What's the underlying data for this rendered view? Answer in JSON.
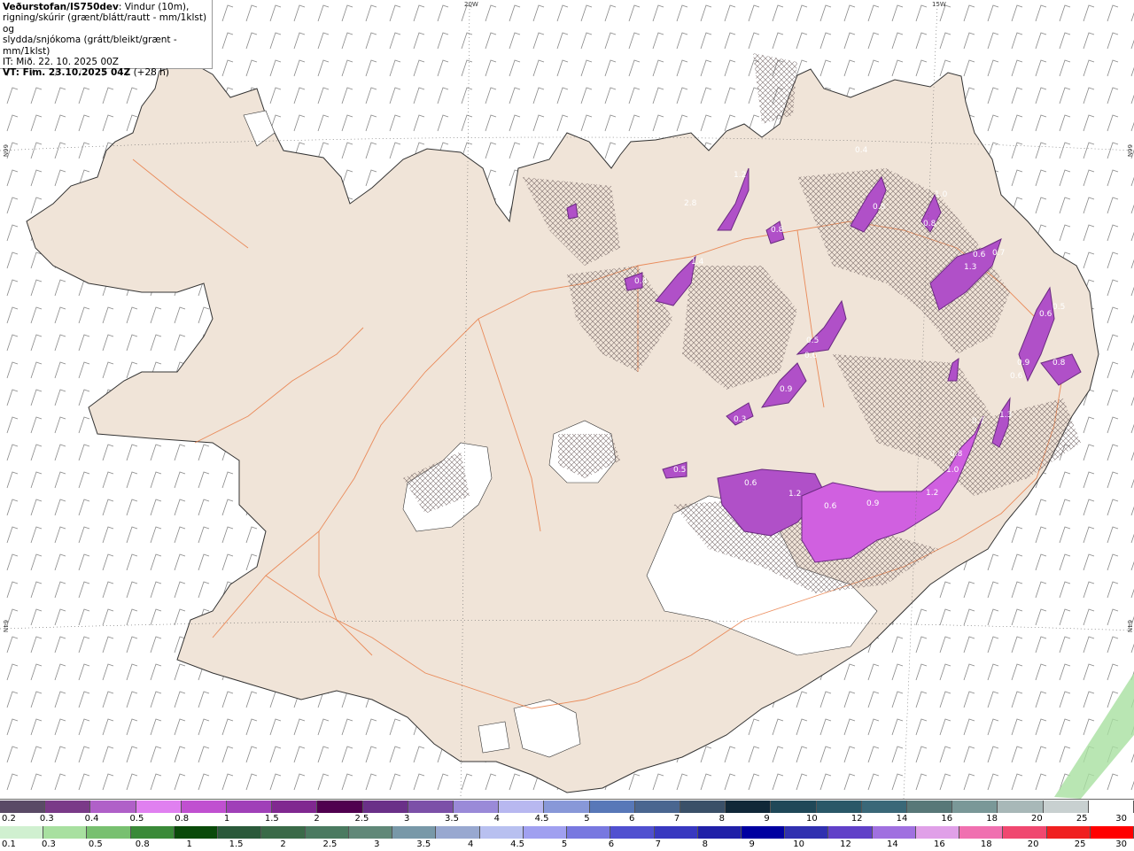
{
  "info": {
    "source": "Veðurstofan/IS750dev",
    "line1_rest": ": Vindur (10m),",
    "line2": "rigning/skúrir (grænt/blátt/rautt - mm/1klst) og",
    "line3": "slydda/snjókoma (grátt/bleikt/grænt - mm/1klst)",
    "it": "IT: Mið. 22. 10. 2025 00Z",
    "vt_bold": "VT: Fim. 23.10.2025 04Z",
    "vt_rest": " (+28 h)"
  },
  "grid_labels": {
    "top_20w": "20W",
    "top_15w": "15W",
    "left_66n": "66N",
    "right_66n": "66N",
    "left_64n": "64N",
    "right_64n": "64N"
  },
  "precip_values": [
    "0.4",
    "0.8",
    "1.0",
    "0.8",
    "0.8",
    "1.2",
    "2.8",
    "1.3",
    "0.7",
    "0.6",
    "0.5",
    "0.6",
    "0.9",
    "0.6",
    "0.8",
    "0.5",
    "0.6",
    "0.9",
    "0.3",
    "0.5",
    "0.6",
    "1.2",
    "0.6",
    "0.9",
    "1.2",
    "1.0",
    "0.8",
    "0.7",
    "1.3",
    "0.4",
    "1.4"
  ],
  "legend": {
    "snow_colors": [
      "#5a4a66",
      "#7a3a88",
      "#b060c8",
      "#e080f0",
      "#c050d0",
      "#a040b8",
      "#802890",
      "#50004f",
      "#6a3088",
      "#7c50a8",
      "#9a8ad8",
      "#b8b8f0",
      "#8898d8",
      "#5878b8",
      "#4a6690",
      "#3a5068",
      "#102838",
      "#204858",
      "#2a5868",
      "#3a6878",
      "#587878",
      "#7a9898",
      "#a8b8b8",
      "#c8d0d0",
      "#ffffff"
    ],
    "snow_labels": [
      "0.2",
      "0.3",
      "0.4",
      "0.5",
      "0.8",
      "1",
      "1.5",
      "2",
      "2.5",
      "3",
      "3.5",
      "4",
      "4.5",
      "5",
      "6",
      "7",
      "8",
      "9",
      "10",
      "12",
      "14",
      "16",
      "18",
      "20",
      "25",
      "30"
    ],
    "rain_colors": [
      "#d0f0d0",
      "#a8e0a0",
      "#78c070",
      "#3a8a38",
      "#0a4a0a",
      "#2a5a3a",
      "#3a6a48",
      "#4a7a60",
      "#608878",
      "#7898a8",
      "#98a8d0",
      "#b8c0f0",
      "#a0a0f0",
      "#7878e0",
      "#5050d0",
      "#3838c0",
      "#2020a8",
      "#0000a0",
      "#3030b0",
      "#6040c8",
      "#a070e0",
      "#e0a0e8",
      "#f070b0",
      "#f04870",
      "#f02020",
      "#ff0000"
    ],
    "rain_labels": [
      "0.1",
      "0.3",
      "0.5",
      "0.8",
      "1",
      "1.5",
      "2",
      "2.5",
      "3",
      "3.5",
      "4",
      "4.5",
      "5",
      "6",
      "7",
      "8",
      "9",
      "10",
      "12",
      "14",
      "16",
      "18",
      "20",
      "25",
      "30"
    ]
  }
}
